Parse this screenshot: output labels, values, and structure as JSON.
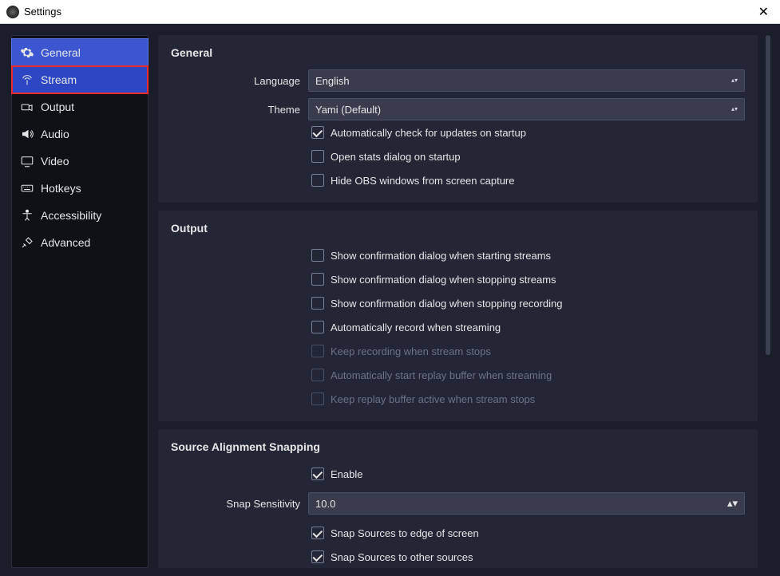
{
  "window": {
    "title": "Settings"
  },
  "sidebar": {
    "items": [
      {
        "id": "general",
        "label": "General"
      },
      {
        "id": "stream",
        "label": "Stream"
      },
      {
        "id": "output",
        "label": "Output"
      },
      {
        "id": "audio",
        "label": "Audio"
      },
      {
        "id": "video",
        "label": "Video"
      },
      {
        "id": "hotkeys",
        "label": "Hotkeys"
      },
      {
        "id": "accessibility",
        "label": "Accessibility"
      },
      {
        "id": "advanced",
        "label": "Advanced"
      }
    ],
    "selected": "general",
    "highlighted": "stream"
  },
  "panels": {
    "general": {
      "title": "General",
      "language_label": "Language",
      "language_value": "English",
      "theme_label": "Theme",
      "theme_value": "Yami (Default)",
      "checks": [
        {
          "label": "Automatically check for updates on startup",
          "checked": true,
          "disabled": false
        },
        {
          "label": "Open stats dialog on startup",
          "checked": false,
          "disabled": false
        },
        {
          "label": "Hide OBS windows from screen capture",
          "checked": false,
          "disabled": false
        }
      ]
    },
    "output": {
      "title": "Output",
      "checks": [
        {
          "label": "Show confirmation dialog when starting streams",
          "checked": false,
          "disabled": false
        },
        {
          "label": "Show confirmation dialog when stopping streams",
          "checked": false,
          "disabled": false
        },
        {
          "label": "Show confirmation dialog when stopping recording",
          "checked": false,
          "disabled": false
        },
        {
          "label": "Automatically record when streaming",
          "checked": false,
          "disabled": false
        },
        {
          "label": "Keep recording when stream stops",
          "checked": false,
          "disabled": true
        },
        {
          "label": "Automatically start replay buffer when streaming",
          "checked": false,
          "disabled": true
        },
        {
          "label": "Keep replay buffer active when stream stops",
          "checked": false,
          "disabled": true
        }
      ]
    },
    "snapping": {
      "title": "Source Alignment Snapping",
      "enable_label": "Enable",
      "enable_checked": true,
      "sensitivity_label": "Snap Sensitivity",
      "sensitivity_value": "10.0",
      "checks": [
        {
          "label": "Snap Sources to edge of screen",
          "checked": true,
          "disabled": false
        },
        {
          "label": "Snap Sources to other sources",
          "checked": true,
          "disabled": false
        }
      ]
    }
  }
}
